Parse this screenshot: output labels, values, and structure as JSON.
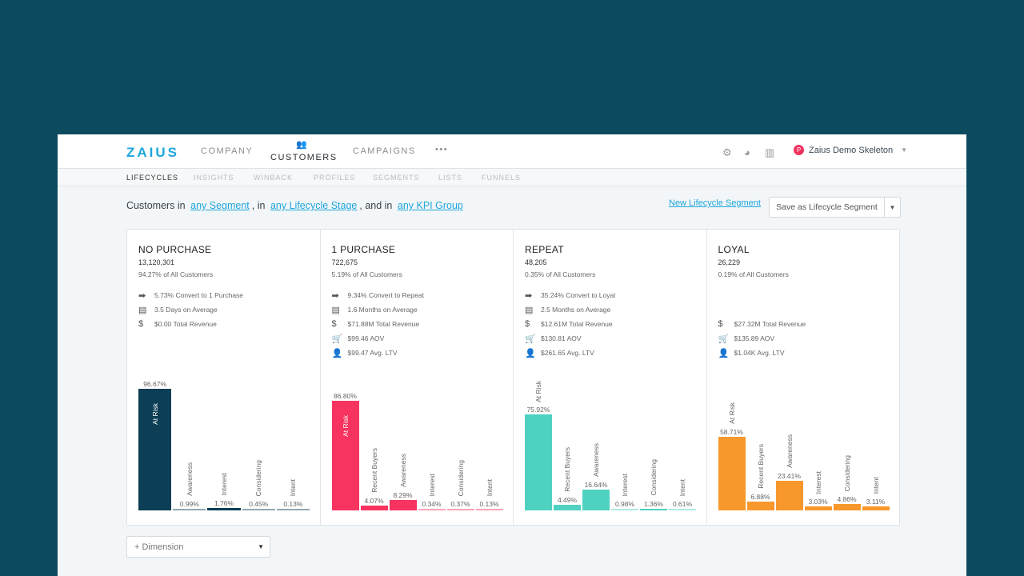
{
  "header": {
    "logo": "ZAIUS",
    "nav": [
      {
        "label": "COMPANY"
      },
      {
        "label": "CUSTOMERS",
        "active": true
      },
      {
        "label": "CAMPAIGNS"
      },
      {
        "label": "•••"
      }
    ],
    "user": {
      "initial": "P",
      "name": "Zaius Demo Skeleton"
    },
    "icons": [
      "gear-icon",
      "pie-chart-icon",
      "library-icon"
    ]
  },
  "subnav": [
    {
      "label": "LIFECYCLES",
      "active": true
    },
    {
      "label": "INSIGHTS"
    },
    {
      "label": "WINBACK"
    },
    {
      "label": "PROFILES"
    },
    {
      "label": "SEGMENTS"
    },
    {
      "label": "LISTS"
    },
    {
      "label": "FUNNELS"
    }
  ],
  "filter": {
    "prefix": "Customers in",
    "segment": "any Segment",
    "mid1": ", in",
    "stage": "any Lifecycle Stage",
    "mid2": ", and in",
    "kpi": "any KPI Group"
  },
  "actions": {
    "new_segment": "New Lifecycle Segment",
    "save": "Save as Lifecycle Segment"
  },
  "dimension": {
    "label": "+ Dimension"
  },
  "chart_data": {
    "type": "bar",
    "ylim": [
      0,
      100
    ],
    "columns": [
      {
        "title": "NO PURCHASE",
        "count": "13,120,301",
        "share": "94.27% of All Customers",
        "color": "#0c3f55",
        "stats": [
          {
            "icon": "arrow-icon",
            "text": "5.73% Convert to 1 Purchase"
          },
          {
            "icon": "calendar-icon",
            "text": "3.5 Days on Average"
          },
          {
            "icon": "dollar-icon",
            "text": "$0.00 Total Revenue"
          }
        ],
        "categories": [
          "At Risk",
          "Awareness",
          "Interest",
          "Considering",
          "Intent"
        ],
        "values": [
          96.67,
          0.99,
          1.76,
          0.45,
          0.13
        ],
        "labels": [
          "96.67%",
          "0.99%",
          "1.76%",
          "0.45%",
          "0.13%"
        ]
      },
      {
        "title": "1 PURCHASE",
        "count": "722,675",
        "share": "5.19% of All Customers",
        "color": "#f7335f",
        "stats": [
          {
            "icon": "arrow-icon",
            "text": "9.34% Convert to Repeat"
          },
          {
            "icon": "calendar-icon",
            "text": "1.6 Months on Average"
          },
          {
            "icon": "dollar-icon",
            "text": "$71.88M Total Revenue"
          },
          {
            "icon": "cart-icon",
            "text": "$99.46 AOV"
          },
          {
            "icon": "user-icon",
            "text": "$99.47 Avg. LTV"
          }
        ],
        "categories": [
          "At Risk",
          "Recent Buyers",
          "Awareness",
          "Interest",
          "Considering",
          "Intent"
        ],
        "values": [
          86.8,
          4.07,
          8.29,
          0.34,
          0.37,
          0.13
        ],
        "labels": [
          "86.80%",
          "4.07%",
          "8.29%",
          "0.34%",
          "0.37%",
          "0.13%"
        ]
      },
      {
        "title": "REPEAT",
        "count": "48,205",
        "share": "0.35% of All Customers",
        "color": "#4fd1c2",
        "stats": [
          {
            "icon": "arrow-icon",
            "text": "35.24% Convert to Loyal"
          },
          {
            "icon": "calendar-icon",
            "text": "2.5 Months on Average"
          },
          {
            "icon": "dollar-icon",
            "text": "$12.61M Total Revenue"
          },
          {
            "icon": "cart-icon",
            "text": "$130.81 AOV"
          },
          {
            "icon": "user-icon",
            "text": "$261.65 Avg. LTV"
          }
        ],
        "categories": [
          "At Risk",
          "Recent Buyers",
          "Awareness",
          "Interest",
          "Considering",
          "Intent"
        ],
        "values": [
          75.92,
          4.49,
          16.64,
          0.98,
          1.36,
          0.61
        ],
        "labels": [
          "75.92%",
          "4.49%",
          "16.64%",
          "0.98%",
          "1.36%",
          "0.61%"
        ]
      },
      {
        "title": "LOYAL",
        "count": "26,229",
        "share": "0.19% of All Customers",
        "color": "#f8982c",
        "stats": [
          {
            "icon": "",
            "text": ""
          },
          {
            "icon": "",
            "text": ""
          },
          {
            "icon": "dollar-icon",
            "text": "$27.32M Total Revenue"
          },
          {
            "icon": "cart-icon",
            "text": "$135.89 AOV"
          },
          {
            "icon": "user-icon",
            "text": "$1.04K Avg. LTV"
          }
        ],
        "categories": [
          "At Risk",
          "Recent Buyers",
          "Awareness",
          "Interest",
          "Considering",
          "Intent"
        ],
        "values": [
          58.71,
          6.88,
          23.41,
          3.03,
          4.86,
          3.11
        ],
        "labels": [
          "58.71%",
          "6.88%",
          "23.41%",
          "3.03%",
          "4.86%",
          "3.11%"
        ]
      }
    ]
  }
}
